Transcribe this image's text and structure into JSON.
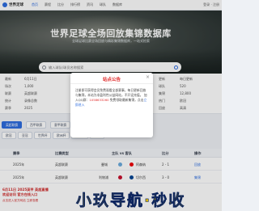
{
  "topnav": {
    "logo": "世界足球",
    "items": [
      "首页",
      "赛程",
      "比分",
      "排行榜",
      "资讯",
      "球队",
      "数据库"
    ],
    "right": "登录 · 注册"
  },
  "hero": {
    "title": "世界足球全场回放集锦数据库",
    "subtitle": "全球足球比赛全场回放与精彩集锦数据库，一站式检索",
    "search_placeholder": "输入球队/球员名称搜索"
  },
  "stats": [
    {
      "label": "最新",
      "value": "6月11日"
    },
    {
      "label": "场次",
      "value": "1,000"
    },
    {
      "label": "联赛",
      "value": "英超联赛"
    },
    {
      "label": "统计",
      "value": "录像总数"
    },
    {
      "label": "赛季",
      "value": "2025"
    },
    {
      "label": "更新",
      "value": "每日更新"
    },
    {
      "label": "球队",
      "value": "520"
    },
    {
      "label": "集锦",
      "value": "12,800"
    },
    {
      "label": "热门",
      "value": "欧冠"
    },
    {
      "label": "回放",
      "value": "高清"
    }
  ],
  "filters": [
    {
      "label": "英超联赛",
      "active": true
    },
    {
      "label": "西甲联赛",
      "active": false
    },
    {
      "label": "意甲联赛",
      "active": false
    },
    {
      "label": "德甲联赛",
      "active": false
    },
    {
      "label": "法甲联赛",
      "active": false
    },
    {
      "label": "中超联赛",
      "active": false
    },
    {
      "label": "欧冠",
      "active": false
    },
    {
      "label": "亚冠",
      "active": false
    },
    {
      "label": "世界杯",
      "active": false
    },
    {
      "label": "欧洲杯",
      "active": false
    },
    {
      "label": "美洲杯",
      "active": false
    },
    {
      "label": "更多",
      "active": false
    }
  ],
  "table": {
    "headers": [
      "赛季",
      "比赛类型",
      "主队 vs 客队",
      "比分",
      "操作"
    ],
    "rows": [
      {
        "season": "2025年",
        "type": "英超联赛",
        "home": "曼城",
        "away": "阿森纳",
        "score": "2 - 1",
        "action": "回放"
      },
      {
        "season": "2025年",
        "type": "英超联赛",
        "home": "利物浦",
        "away": "切尔西",
        "score": "3 - 0",
        "action": "集锦"
      }
    ]
  },
  "ad": {
    "left_line1": "6月11日 2025英甲 英超直播",
    "left_line2": "欢迎访问 官方在线入口",
    "logo": "小玖导航·秒收",
    "sub": "点击进入官方网站 立即查看"
  },
  "modal": {
    "title": "站点公告",
    "close": "×",
    "body_1": "注册即可获得会员免费观看全部赛事，每日更新回放与集锦，本站为非盈利性公益网站，不开设充值。",
    "body_2": "加入QQ群：",
    "body_2_hl": "1058633260",
    "body_3": "免费领取最新集锦，点击",
    "body_3_link": "立即进入"
  },
  "colors": {
    "accent": "#2d6cdf",
    "alert": "#e02a2a",
    "ad_yellow": "#ffd400"
  }
}
